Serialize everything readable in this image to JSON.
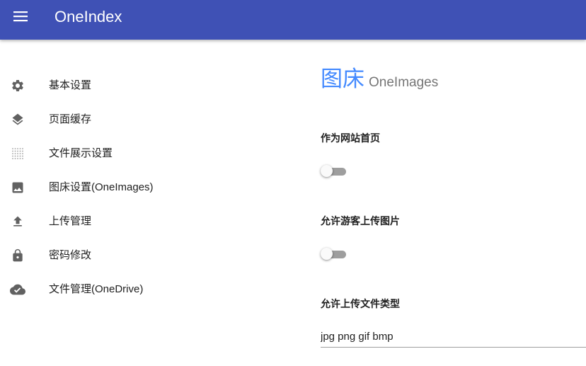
{
  "app": {
    "title": "OneIndex",
    "menu_icon": "menu-icon",
    "primary_color": "#3f51b5",
    "accent_color": "#448aff"
  },
  "sidebar": {
    "items": [
      {
        "label": "基本设置",
        "icon": "gear-icon"
      },
      {
        "label": "页面缓存",
        "icon": "layers-icon"
      },
      {
        "label": "文件展示设置",
        "icon": "grid-dots-icon"
      },
      {
        "label": "图床设置(OneImages)",
        "icon": "image-icon"
      },
      {
        "label": "上传管理",
        "icon": "upload-icon"
      },
      {
        "label": "密码修改",
        "icon": "lock-icon"
      },
      {
        "label": "文件管理(OneDrive)",
        "icon": "cloud-done-icon"
      }
    ]
  },
  "main": {
    "title": "图床",
    "subtitle": "OneImages",
    "settings": [
      {
        "label": "作为网站首页",
        "type": "switch",
        "checked": false
      },
      {
        "label": "允许游客上传图片",
        "type": "switch",
        "checked": false
      },
      {
        "label": "允许上传文件类型",
        "type": "text",
        "value": "jpg png gif bmp"
      }
    ]
  }
}
